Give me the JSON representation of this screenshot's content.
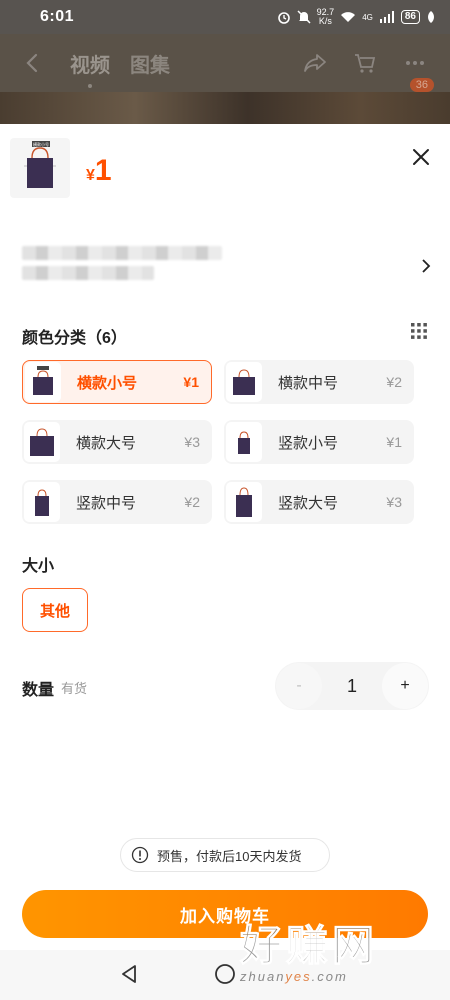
{
  "status_bar": {
    "time": "6:01",
    "speed_value": "92.7",
    "speed_unit": "K/s",
    "network": "4G",
    "battery": "86"
  },
  "top_nav": {
    "tabs": [
      "视频",
      "图集"
    ],
    "active_tab": "视频",
    "cart_badge": "36"
  },
  "product": {
    "thumb_label": "横款小号",
    "currency": "¥",
    "price": "1"
  },
  "color_section": {
    "title": "颜色分类（6）",
    "options": [
      {
        "label": "横款小号",
        "price": "¥1",
        "selected": true
      },
      {
        "label": "横款中号",
        "price": "¥2",
        "selected": false
      },
      {
        "label": "横款大号",
        "price": "¥3",
        "selected": false
      },
      {
        "label": "竖款小号",
        "price": "¥1",
        "selected": false
      },
      {
        "label": "竖款中号",
        "price": "¥2",
        "selected": false
      },
      {
        "label": "竖款大号",
        "price": "¥3",
        "selected": false
      }
    ]
  },
  "size_section": {
    "title": "大小",
    "option": "其他"
  },
  "quantity": {
    "label": "数量",
    "stock": "有货",
    "minus": "-",
    "value": "1",
    "plus": "+"
  },
  "notice": {
    "text": "预售，付款后10天内发货"
  },
  "cta": {
    "label": "加入购物车"
  },
  "watermark": {
    "main": "好赚网",
    "sub_a": "zhuan",
    "sub_b": "yes",
    "sub_c": ".com"
  },
  "colors": {
    "accent": "#ff5000",
    "cta_start": "#ff9500",
    "cta_end": "#ff7a00",
    "bag": "#3b2f52"
  }
}
